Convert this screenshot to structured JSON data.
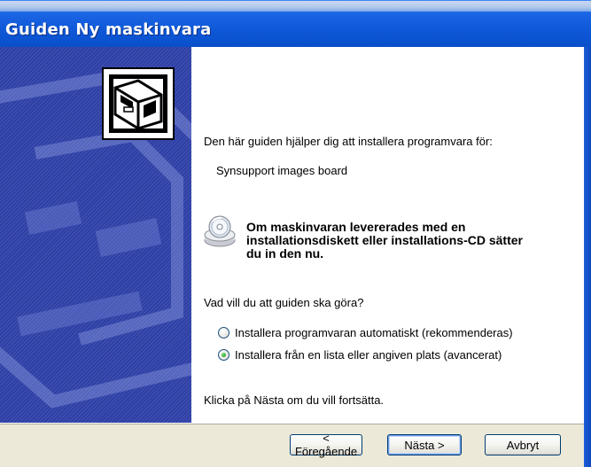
{
  "window": {
    "title": "Guiden Ny maskinvara"
  },
  "content": {
    "intro": "Den här guiden hjälper dig att installera programvara för:",
    "device_name": "Synsupport images board",
    "cd_note": "Om maskinvaran levererades med en\ninstallationsdiskett eller installations-CD sätter\ndu in den nu.",
    "question": "Vad vill du att guiden ska göra?",
    "options": [
      {
        "label": "Installera programvaran automatiskt (rekommenderas)",
        "selected": false
      },
      {
        "label": "Installera från en lista eller angiven plats (avancerat)",
        "selected": true
      }
    ],
    "continue_hint": "Klicka på Nästa om du vill fortsätta."
  },
  "buttons": {
    "back": "< Föregående",
    "next": "Nästa >",
    "cancel": "Avbryt"
  },
  "icons": {
    "wizard": "hardware-install-icon",
    "cd": "cd-drive-icon"
  },
  "colors": {
    "titlebar": "#0c56d6",
    "watermark": "#2e3fa6",
    "button_bar": "#ece9d8"
  }
}
